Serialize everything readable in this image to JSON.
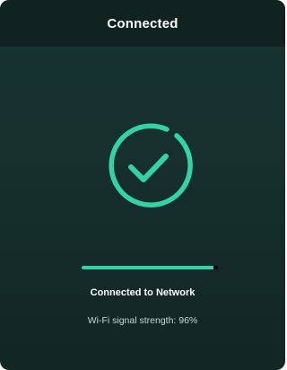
{
  "header": {
    "title": "Connected"
  },
  "status": {
    "icon": "check-circle-icon",
    "title": "Connected to Network",
    "detail": "Wi-Fi signal strength: 96%"
  },
  "progress": {
    "value": 0.97
  },
  "colors": {
    "accent": "#34d3a6",
    "header_bg": "#102321",
    "panel_bg": "#16302e"
  }
}
